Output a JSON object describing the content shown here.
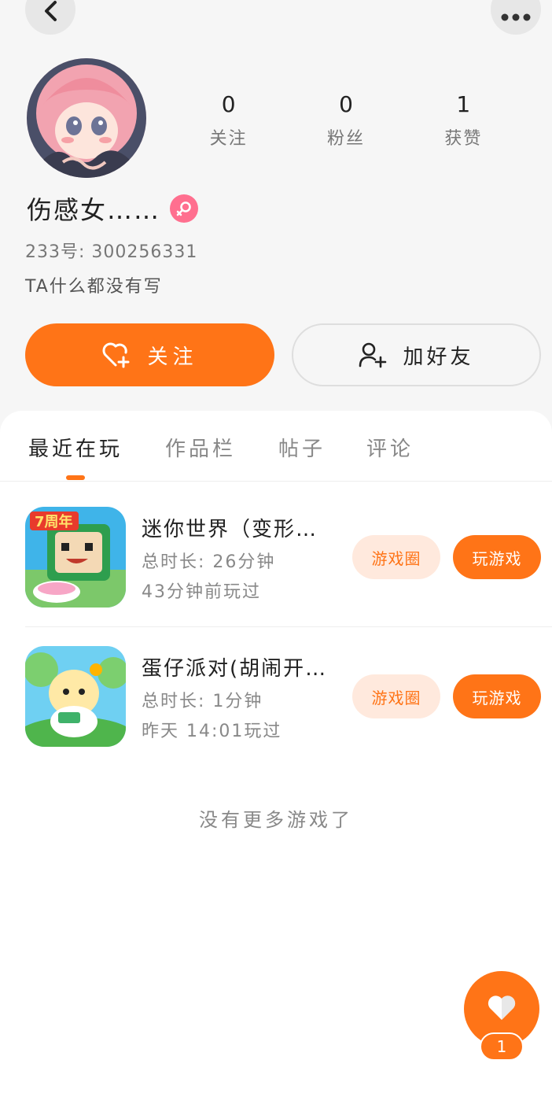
{
  "header": {
    "back_icon": "chevron-left-icon",
    "more_icon": "more-dots-icon"
  },
  "profile": {
    "stats": [
      {
        "value": "0",
        "label": "关注"
      },
      {
        "value": "0",
        "label": "粉丝"
      },
      {
        "value": "1",
        "label": "获赞"
      }
    ],
    "nickname": "伤感女……",
    "gender_icon": "female-icon",
    "account_id": "233号: 300256331",
    "bio": "TA什么都没有写",
    "follow_label": "关注",
    "add_friend_label": "加好友"
  },
  "tabs": [
    {
      "label": "最近在玩",
      "active": true
    },
    {
      "label": "作品栏",
      "active": false
    },
    {
      "label": "帖子",
      "active": false
    },
    {
      "label": "评论",
      "active": false
    }
  ],
  "games": [
    {
      "title": "迷你世界（变形…",
      "duration": "总时长: 26分钟",
      "last_played": "43分钟前玩过",
      "circle_label": "游戏圈",
      "play_label": "玩游戏"
    },
    {
      "title": "蛋仔派对(胡闹开…",
      "duration": "总时长: 1分钟",
      "last_played": "昨天 14:01玩过",
      "circle_label": "游戏圈",
      "play_label": "玩游戏"
    }
  ],
  "no_more_text": "没有更多游戏了",
  "like_fab": {
    "icon": "heart-icon",
    "count": "1"
  },
  "colors": {
    "accent": "#ff7417",
    "accent_light": "#ffe9dd",
    "gender_pink": "#ff6f8f"
  }
}
